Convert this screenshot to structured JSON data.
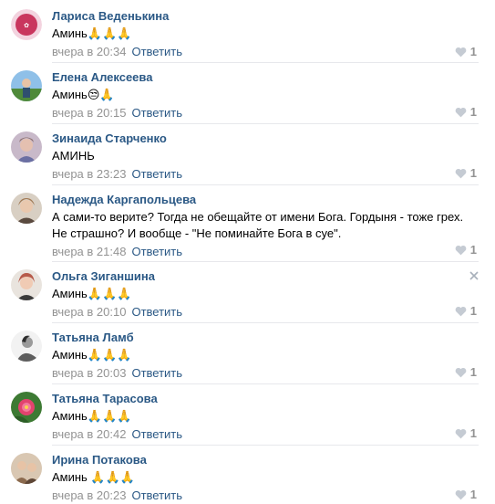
{
  "reply_label": "Ответить",
  "comments": [
    {
      "author": "Лариса Веденькина",
      "text": "Аминь🙏🙏🙏",
      "time": "вчера в 20:34",
      "likes": "1",
      "avatar": "#c9365e"
    },
    {
      "author": "Елена Алексеева",
      "text": "Аминь😒🙏",
      "time": "вчера в 20:15",
      "likes": "1",
      "avatar": "#4f8a3a"
    },
    {
      "author": "Зинаида Старченко",
      "text": "АМИНЬ",
      "time": "вчера в 23:23",
      "likes": "1",
      "avatar": "#6b6fa3"
    },
    {
      "author": "Надежда Каргапольцева",
      "text": "А сами-то верите? Тогда не обещайте от имени Бога. Гордыня - тоже грех. Не страшно? И вообще - \"Не поминайте Бога в суе\".",
      "time": "вчера в 21:48",
      "likes": "1",
      "avatar": "#a27a55"
    },
    {
      "author": "Ольга Зиганшина",
      "text": "Аминь🙏🙏🙏",
      "time": "вчера в 20:10",
      "likes": "1",
      "avatar": "#b75b4a"
    },
    {
      "author": "Татьяна Ламб",
      "text": "Аминь🙏🙏🙏",
      "time": "вчера в 20:03",
      "likes": "1",
      "avatar": "#cfcfcf"
    },
    {
      "author": "Татьяна Тарасова",
      "text": "Аминь🙏🙏🙏",
      "time": "вчера в 20:42",
      "likes": "1",
      "avatar": "#3d7a33"
    },
    {
      "author": "Ирина Потакова",
      "text": "Аминь 🙏🙏🙏",
      "time": "вчера в 20:23",
      "likes": "1",
      "avatar": "#8b6a4e"
    }
  ]
}
